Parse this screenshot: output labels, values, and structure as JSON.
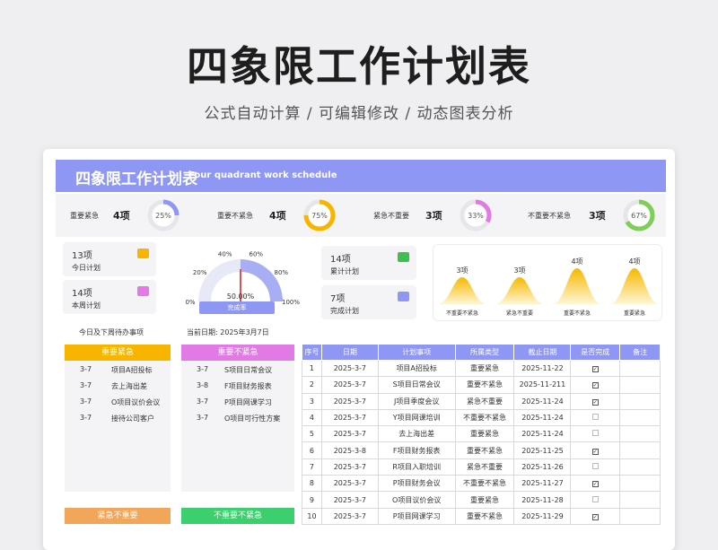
{
  "header": {
    "title": "四象限工作计划表",
    "subtitle": "公式自动计算 /  可编辑修改  / 动态图表分析"
  },
  "sheet": {
    "banner_cn": "四象限工作计划表",
    "banner_en": "Four quadrant work schedule",
    "stats": [
      {
        "label": "重要紧急",
        "count": "4项",
        "pct": "25%",
        "pct_value": 0.25,
        "color": "#8f97f5"
      },
      {
        "label": "重要不紧急",
        "count": "4项",
        "pct": "75%",
        "pct_value": 0.75,
        "color": "#f7b500"
      },
      {
        "label": "紧急不重要",
        "count": "3项",
        "pct": "33%",
        "pct_value": 0.33,
        "color": "#e27ae6"
      },
      {
        "label": "不重要不紧急",
        "count": "3项",
        "pct": "67%",
        "pct_value": 0.67,
        "color": "#7ecf5a"
      }
    ],
    "today": {
      "count": "13项",
      "label": "今日计划",
      "icon": "calendar-icon",
      "color": "#f7b500"
    },
    "week": {
      "count": "14项",
      "label": "本周计划",
      "icon": "chat-icon",
      "color": "#e27ae6"
    },
    "total": {
      "count": "14项",
      "label": "累计计划",
      "icon": "list-icon",
      "color": "#3fbf4f"
    },
    "done": {
      "count": "7项",
      "label": "完成计划",
      "icon": "list-icon",
      "color": "#8f97f5"
    },
    "gauge": {
      "value": 0.5,
      "value_text": "50.00%",
      "button": "完成率",
      "ticks": [
        "0%",
        "20%",
        "40%",
        "60%",
        "80%",
        "100%"
      ]
    },
    "bell_chart": {
      "categories": [
        "不重要不紧急",
        "紧急不重要",
        "重要不紧急",
        "重要紧急"
      ],
      "values": [
        3,
        3,
        4,
        4
      ],
      "labels": [
        "3项",
        "3项",
        "4项",
        "4项"
      ]
    },
    "pending_title": "今日及下周待办事项",
    "date_label": "当前日期:  2025年3月7日",
    "quadrants": [
      {
        "title": "重要紧急",
        "color": "#f7b500",
        "items": [
          {
            "date": "3-7",
            "name": "项目A招投标"
          },
          {
            "date": "3-7",
            "name": "去上海出差"
          },
          {
            "date": "3-7",
            "name": "O项目议价会议"
          },
          {
            "date": "3-7",
            "name": "接待公司客户"
          }
        ]
      },
      {
        "title": "重要不紧急",
        "color": "#e27ae6",
        "items": [
          {
            "date": "3-7",
            "name": "S项目日常会议"
          },
          {
            "date": "3-8",
            "name": "F项目财务报表"
          },
          {
            "date": "3-7",
            "name": "P项目网课学习"
          },
          {
            "date": "3-7",
            "name": "O项目可行性方案"
          }
        ]
      },
      {
        "title": "紧急不重要",
        "color": "#f2a65a"
      },
      {
        "title": "不重要不紧急",
        "color": "#3ccf6e"
      }
    ],
    "table": {
      "headers": [
        "序号",
        "日期",
        "计划事项",
        "所属类型",
        "截止日期",
        "是否完成",
        "备注"
      ],
      "rows": [
        [
          "1",
          "2025-3-7",
          "项目A招投标",
          "重要紧急",
          "2025-11-22",
          true
        ],
        [
          "2",
          "2025-3-7",
          "S项目日常会议",
          "重要不紧急",
          "2025-11-211",
          true
        ],
        [
          "3",
          "2025-3-7",
          "J项目季度会议",
          "紧急不重要",
          "2025-11-24",
          true
        ],
        [
          "4",
          "2025-3-7",
          "Y项目网课培训",
          "不重要不紧急",
          "2025-11-24",
          false
        ],
        [
          "5",
          "2025-3-7",
          "去上海出差",
          "重要紧急",
          "2025-11-24",
          false
        ],
        [
          "6",
          "2025-3-8",
          "F项目财务报表",
          "重要不紧急",
          "2025-11-25",
          true
        ],
        [
          "7",
          "2025-3-7",
          "R项目入职培训",
          "紧急不重要",
          "2025-11-26",
          false
        ],
        [
          "8",
          "2025-3-7",
          "P项目财务会议",
          "不重要不紧急",
          "2025-11-27",
          true
        ],
        [
          "9",
          "2025-3-7",
          "O项目议价会议",
          "重要紧急",
          "2025-11-28",
          false
        ],
        [
          "10",
          "2025-3-7",
          "P项目网课学习",
          "重要不紧急",
          "2025-11-29",
          true
        ]
      ]
    }
  }
}
